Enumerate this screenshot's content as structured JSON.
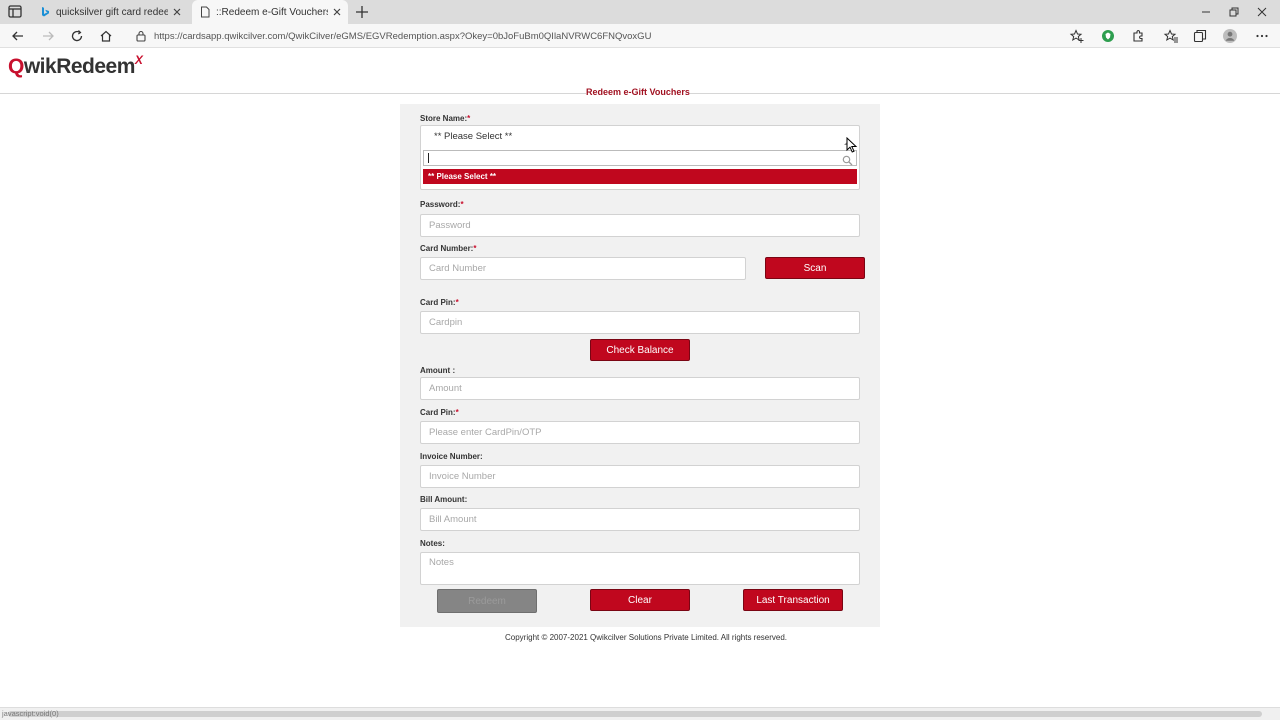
{
  "browser": {
    "tabs": [
      {
        "label": "quicksilver gift card redeem - Bi",
        "active": false,
        "icon": "bing-icon"
      },
      {
        "label": "::Redeem e-Gift Vouchers::",
        "active": true,
        "icon": "page-icon"
      }
    ],
    "url": "https://cardsapp.qwikcilver.com/QwikCilver/eGMS/EGVRedemption.aspx?Okey=0bJoFuBm0QIlaNVRWC6FNQvoxGU",
    "status_text": "javascript:void(0)"
  },
  "logo": {
    "q": "Q",
    "rest": "wikRedeem",
    "x": "X"
  },
  "page": {
    "title": "Redeem e-Gift Vouchers",
    "copyright": "Copyright © 2007-2021 Qwikcilver Solutions Private Limited. All rights reserved."
  },
  "form": {
    "required_mark": "*",
    "store_name": {
      "label": "Store Name:",
      "selected": "** Please Select **",
      "search_value": "",
      "options": [
        "** Please Select **"
      ]
    },
    "password": {
      "label": "Password:",
      "placeholder": "Password"
    },
    "card_number": {
      "label": "Card Number:",
      "placeholder": "Card Number"
    },
    "scan_label": "Scan",
    "card_pin": {
      "label": "Card Pin:",
      "placeholder": "Cardpin"
    },
    "check_balance_label": "Check Balance",
    "amount": {
      "label": "Amount :",
      "placeholder": "Amount"
    },
    "card_pin_otp": {
      "label": "Card Pin:",
      "placeholder": "Please enter CardPin/OTP"
    },
    "invoice_number": {
      "label": "Invoice Number:",
      "placeholder": "Invoice Number"
    },
    "bill_amount": {
      "label": "Bill Amount:",
      "placeholder": "Bill Amount"
    },
    "notes": {
      "label": "Notes:",
      "placeholder": "Notes"
    },
    "redeem_label": "Redeem",
    "clear_label": "Clear",
    "last_transaction_label": "Last Transaction"
  },
  "colors": {
    "accent": "#c0071e",
    "disabled": "#858585",
    "panel": "#f1f1f1"
  }
}
